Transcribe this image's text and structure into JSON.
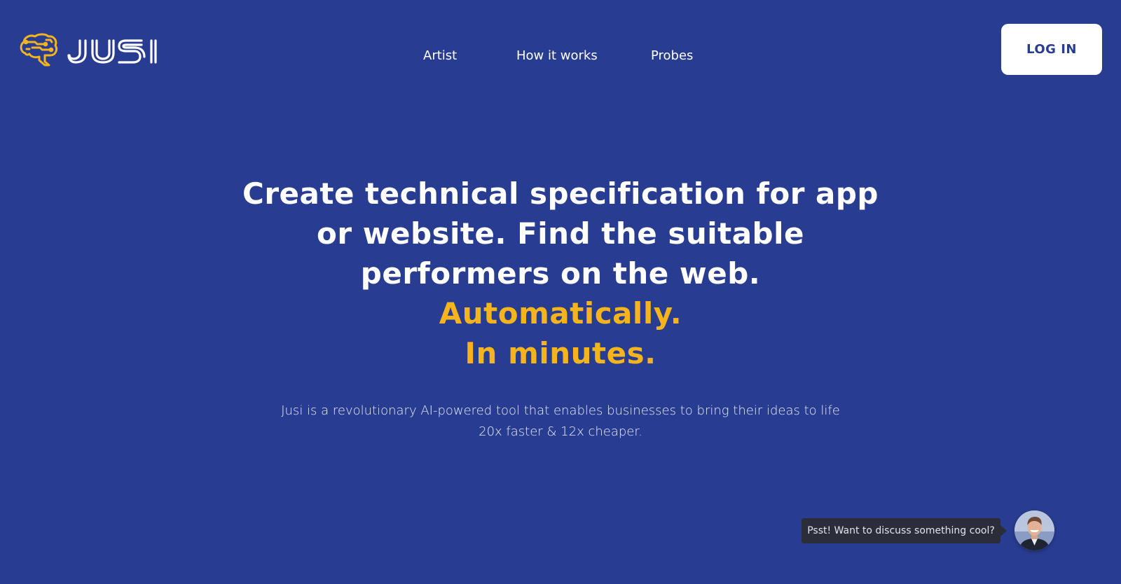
{
  "brand": {
    "name": "JUSI",
    "logo_icon": "brain-circuit-icon",
    "colors": {
      "background": "#283d92",
      "accent": "#f5b31c",
      "text": "#ffffff"
    }
  },
  "nav": {
    "items": [
      {
        "label": "Artist"
      },
      {
        "label": "How it works"
      },
      {
        "label": "Probes"
      }
    ],
    "login_label": "LOG IN"
  },
  "hero": {
    "title_lines": [
      "Create technical specification for app",
      "or website. Find the suitable",
      "performers on the web."
    ],
    "accent_lines": [
      "Automatically.",
      "In minutes."
    ],
    "subtitle_lines": [
      "Jusi is a revolutionary AI-powered tool that enables businesses to bring their ideas to life",
      "20x faster & 12x cheaper."
    ]
  },
  "chat": {
    "message": "Psst! Want to discuss something cool?",
    "avatar_icon": "person-avatar-icon"
  }
}
